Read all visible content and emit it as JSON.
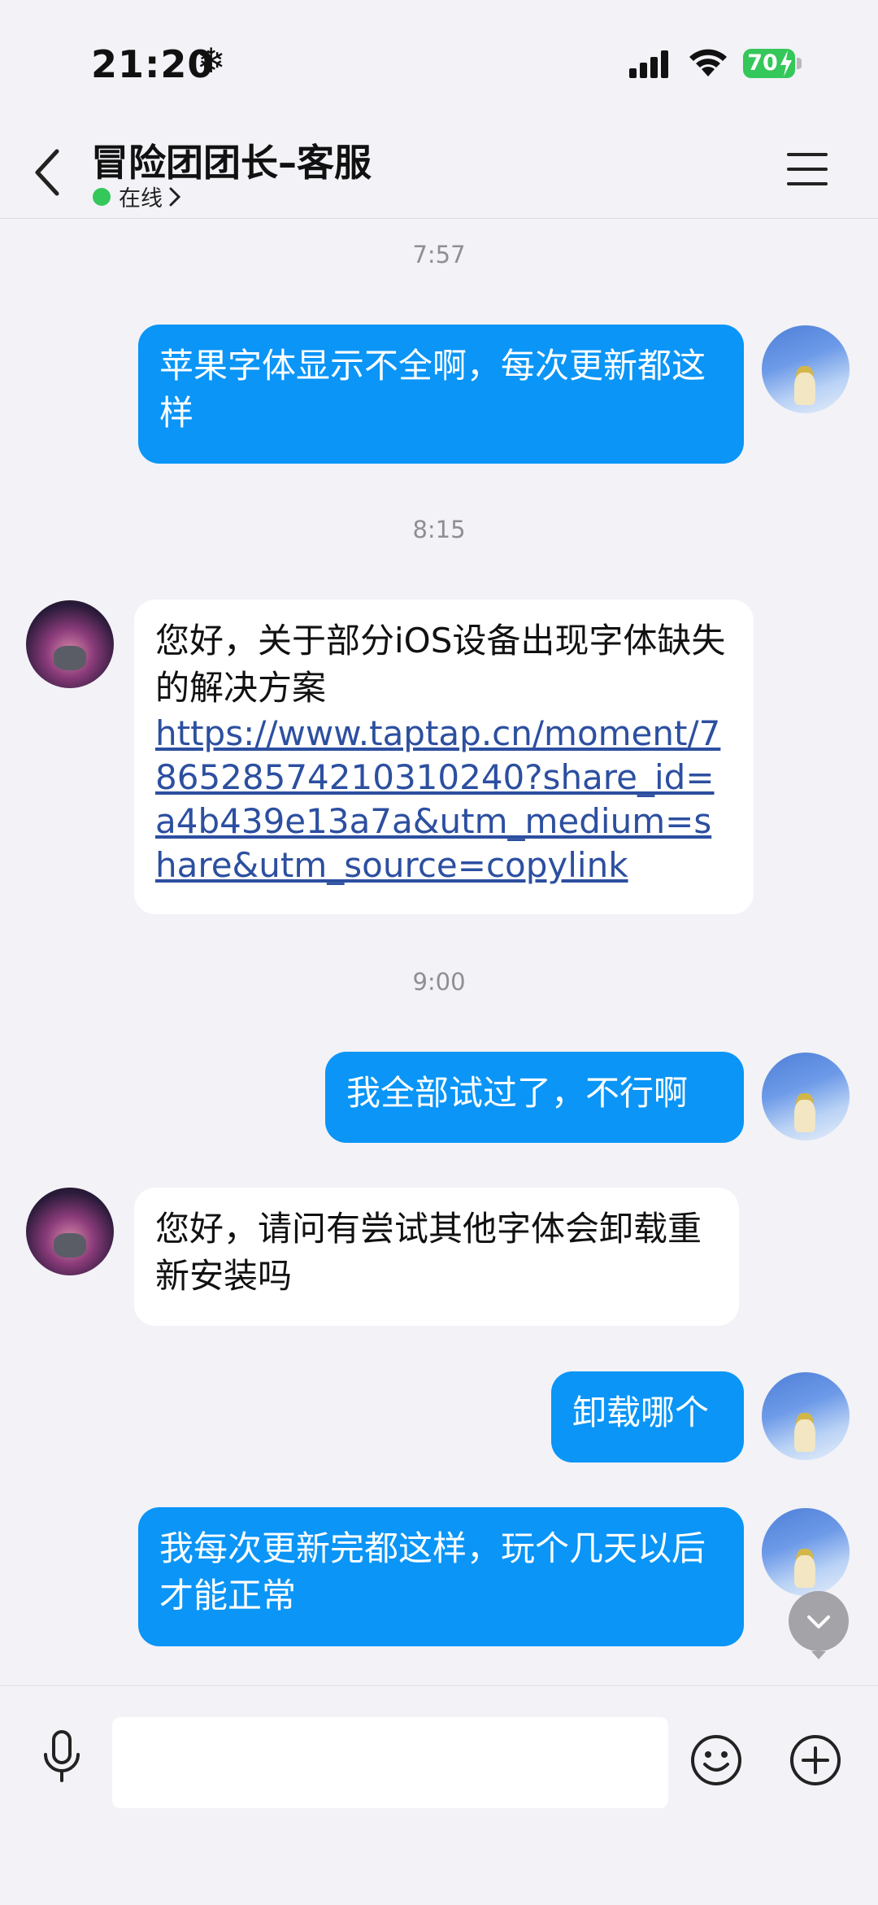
{
  "status_bar": {
    "time": "21:20",
    "battery": "70"
  },
  "header": {
    "title": "冒险团团长–客服",
    "status": "在线"
  },
  "messages": [
    {
      "type": "timestamp",
      "text": "7:57"
    },
    {
      "type": "sent",
      "text": "苹果字体显示不全啊，每次更新都这样"
    },
    {
      "type": "timestamp",
      "text": "8:15"
    },
    {
      "type": "received",
      "text": "您好，关于部分iOS设备出现字体缺失的解决方案",
      "link": "https://www.taptap.cn/moment/786528574210310240?share_id=a4b439e13a7a&utm_medium=share&utm_source=copylink"
    },
    {
      "type": "timestamp",
      "text": "9:00"
    },
    {
      "type": "sent",
      "text": "我全部试过了，不行啊"
    },
    {
      "type": "received",
      "text": "您好，请问有尝试其他字体会卸载重新安装吗"
    },
    {
      "type": "sent",
      "text": "卸载哪个"
    },
    {
      "type": "sent",
      "text": "我每次更新完都这样，玩个几天以后才能正常"
    }
  ],
  "input": {
    "placeholder": ""
  },
  "colors": {
    "sent_bubble": "#0a95f7",
    "received_bubble": "#ffffff",
    "online_dot": "#34c759",
    "background": "#f2f2f7"
  },
  "icons": [
    "back-chevron-icon",
    "menu-icon",
    "microphone-icon",
    "emoji-icon",
    "plus-circle-icon",
    "scroll-down-icon"
  ]
}
